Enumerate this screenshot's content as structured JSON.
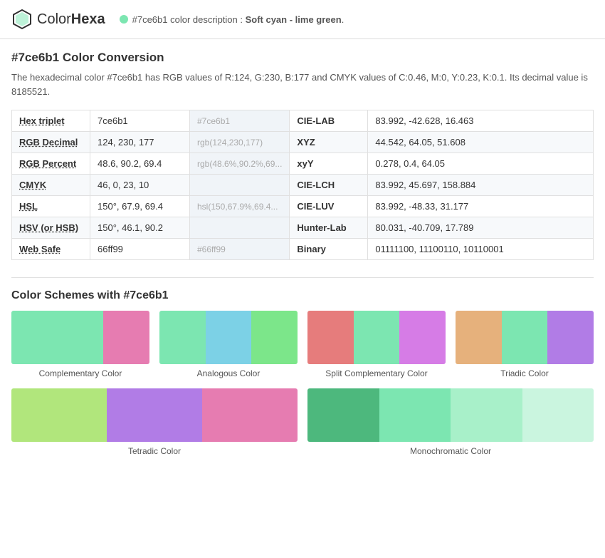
{
  "header": {
    "logo_color": "#7ce6b1",
    "logo_name_plain": "Color",
    "logo_name_bold": "Hexa",
    "color_hex": "#7ce6b1",
    "color_description": "Soft cyan - lime green",
    "desc_prefix": "#7ce6b1 color description : ",
    "desc_bold": "Soft cyan - lime green"
  },
  "page_title": "#7ce6b1 Color Conversion",
  "intro": "The hexadecimal color #7ce6b1 has RGB values of R:124, G:230, B:177 and CMYK values of C:0.46, M:0, Y:0.23, K:0.1. Its decimal value is 8185521.",
  "table": {
    "rows": [
      {
        "label": "Hex triplet",
        "value": "7ce6b1",
        "preview": "#7ce6b1",
        "right_label": "CIE-LAB",
        "right_value": "83.992, -42.628, 16.463"
      },
      {
        "label": "RGB Decimal",
        "value": "124, 230, 177",
        "preview": "rgb(124,230,177)",
        "right_label": "XYZ",
        "right_value": "44.542, 64.05, 51.608"
      },
      {
        "label": "RGB Percent",
        "value": "48.6, 90.2, 69.4",
        "preview": "rgb(48.6%,90.2%,69...",
        "right_label": "xyY",
        "right_value": "0.278, 0.4, 64.05"
      },
      {
        "label": "CMYK",
        "value": "46, 0, 23, 10",
        "preview": "",
        "right_label": "CIE-LCH",
        "right_value": "83.992, 45.697, 158.884"
      },
      {
        "label": "HSL",
        "value": "150°, 67.9, 69.4",
        "preview": "hsl(150,67.9%,69.4...",
        "right_label": "CIE-LUV",
        "right_value": "83.992, -48.33, 31.177"
      },
      {
        "label": "HSV (or HSB)",
        "value": "150°, 46.1, 90.2",
        "preview": "",
        "right_label": "Hunter-Lab",
        "right_value": "80.031, -40.709, 17.789"
      },
      {
        "label": "Web Safe",
        "value": "66ff99",
        "preview": "#66ff99",
        "right_label": "Binary",
        "right_value": "01111100, 11100110, 10110001"
      }
    ]
  },
  "schemes_title": "Color Schemes with #7ce6b1",
  "schemes": [
    {
      "label": "Complementary Color",
      "colors": [
        "#7ce6b1",
        "#7ce6b1",
        "#e67cb1"
      ]
    },
    {
      "label": "Analogous Color",
      "colors": [
        "#7ce6b1",
        "#7cd1e6",
        "#7ce68a"
      ]
    },
    {
      "label": "Split Complementary Color",
      "colors": [
        "#e67c7c",
        "#7ce6b1",
        "#d67ce6"
      ]
    },
    {
      "label": "Triadic Color",
      "colors": [
        "#e6b17c",
        "#7ce6b1",
        "#b17ce6"
      ]
    }
  ],
  "schemes_bottom": [
    {
      "label": "Tetradic Color",
      "colors": [
        "#b1e67c",
        "#b17ce6",
        "#e67cb1"
      ]
    },
    {
      "label": "Monochromatic Color",
      "colors": [
        "#4db87d",
        "#7ce6b1",
        "#a8f0c9",
        "#caf5df"
      ]
    }
  ]
}
